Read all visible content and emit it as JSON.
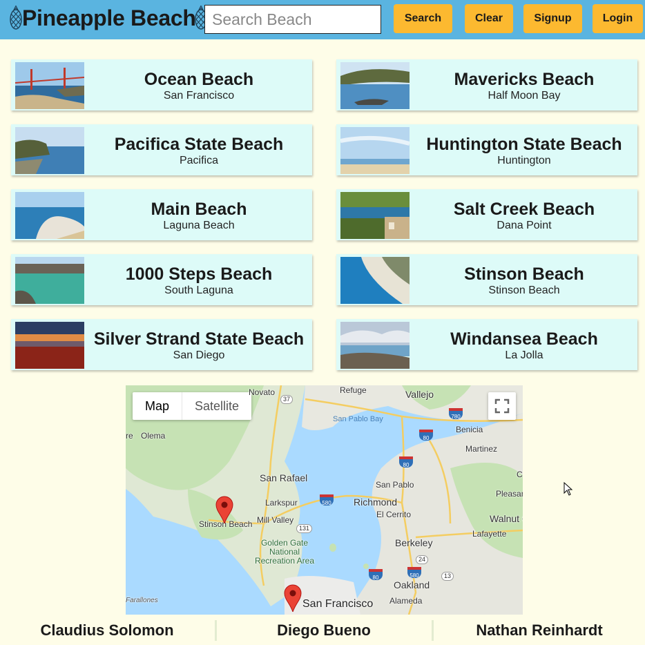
{
  "header": {
    "title": "Pineapple Beach",
    "search_placeholder": "Search Beach",
    "search_value": "",
    "buttons": {
      "search": "Search",
      "clear": "Clear",
      "signup": "Signup",
      "login": "Login"
    },
    "colors": {
      "bar": "#5ab4e0",
      "button": "#fcb930"
    }
  },
  "beaches": [
    {
      "name": "Ocean Beach",
      "city": "San Francisco",
      "thumb": "golden-gate-bridge"
    },
    {
      "name": "Mavericks Beach",
      "city": "Half Moon Bay",
      "thumb": "bluff-tidepool"
    },
    {
      "name": "Pacifica State Beach",
      "city": "Pacifica",
      "thumb": "headland-cove"
    },
    {
      "name": "Huntington State Beach",
      "city": "Huntington",
      "thumb": "wide-sand-beach"
    },
    {
      "name": "Main Beach",
      "city": "Laguna Beach",
      "thumb": "breaking-wave"
    },
    {
      "name": "Salt Creek Beach",
      "city": "Dana Point",
      "thumb": "cliff-houses"
    },
    {
      "name": "1000 Steps Beach",
      "city": "South Laguna",
      "thumb": "rock-pool-swimmer"
    },
    {
      "name": "Stinson Beach",
      "city": "Stinson Beach",
      "thumb": "aerial-beach"
    },
    {
      "name": "Silver Strand State Beach",
      "city": "San Diego",
      "thumb": "sunset-shore"
    },
    {
      "name": "Windansea Beach",
      "city": "La Jolla",
      "thumb": "rocky-shore-clouds"
    }
  ],
  "map": {
    "type_buttons": [
      "Map",
      "Satellite"
    ],
    "selected_type": "Map",
    "labels": {
      "novato": "Novato",
      "refuge": "Refuge",
      "vallejo": "Vallejo",
      "san_pablo_bay": "San Pablo Bay",
      "olema": "Olema",
      "benicia": "Benicia",
      "martinez": "Martinez",
      "re": "re",
      "san_rafael": "San Rafael",
      "san_pablo": "San Pablo",
      "larkspur": "Larkspur",
      "richmond": "Richmond",
      "pleasant": "Pleasan",
      "el_cerrito": "El Cerrito",
      "mill_valley": "Mill Valley",
      "stinson_beach": "Stinson Beach",
      "walnut": "Walnut C",
      "lafayette": "Lafayette",
      "berkeley": "Berkeley",
      "golden_gate": "Golden Gate National Recreation Area",
      "oakland": "Oakland",
      "alameda": "Alameda",
      "san_francisco": "San Francisco",
      "farallones": "Farallones",
      "c": "C"
    },
    "routes": {
      "r37": "37",
      "r780": "780",
      "r80a": "80",
      "r80b": "80",
      "r580a": "580",
      "r131": "131",
      "r24": "24",
      "r80c": "80",
      "r580b": "580",
      "r13": "13"
    },
    "markers": [
      "Stinson Beach",
      "San Francisco"
    ]
  },
  "team": [
    "Claudius Solomon",
    "Diego Bueno",
    "Nathan Reinhardt"
  ]
}
